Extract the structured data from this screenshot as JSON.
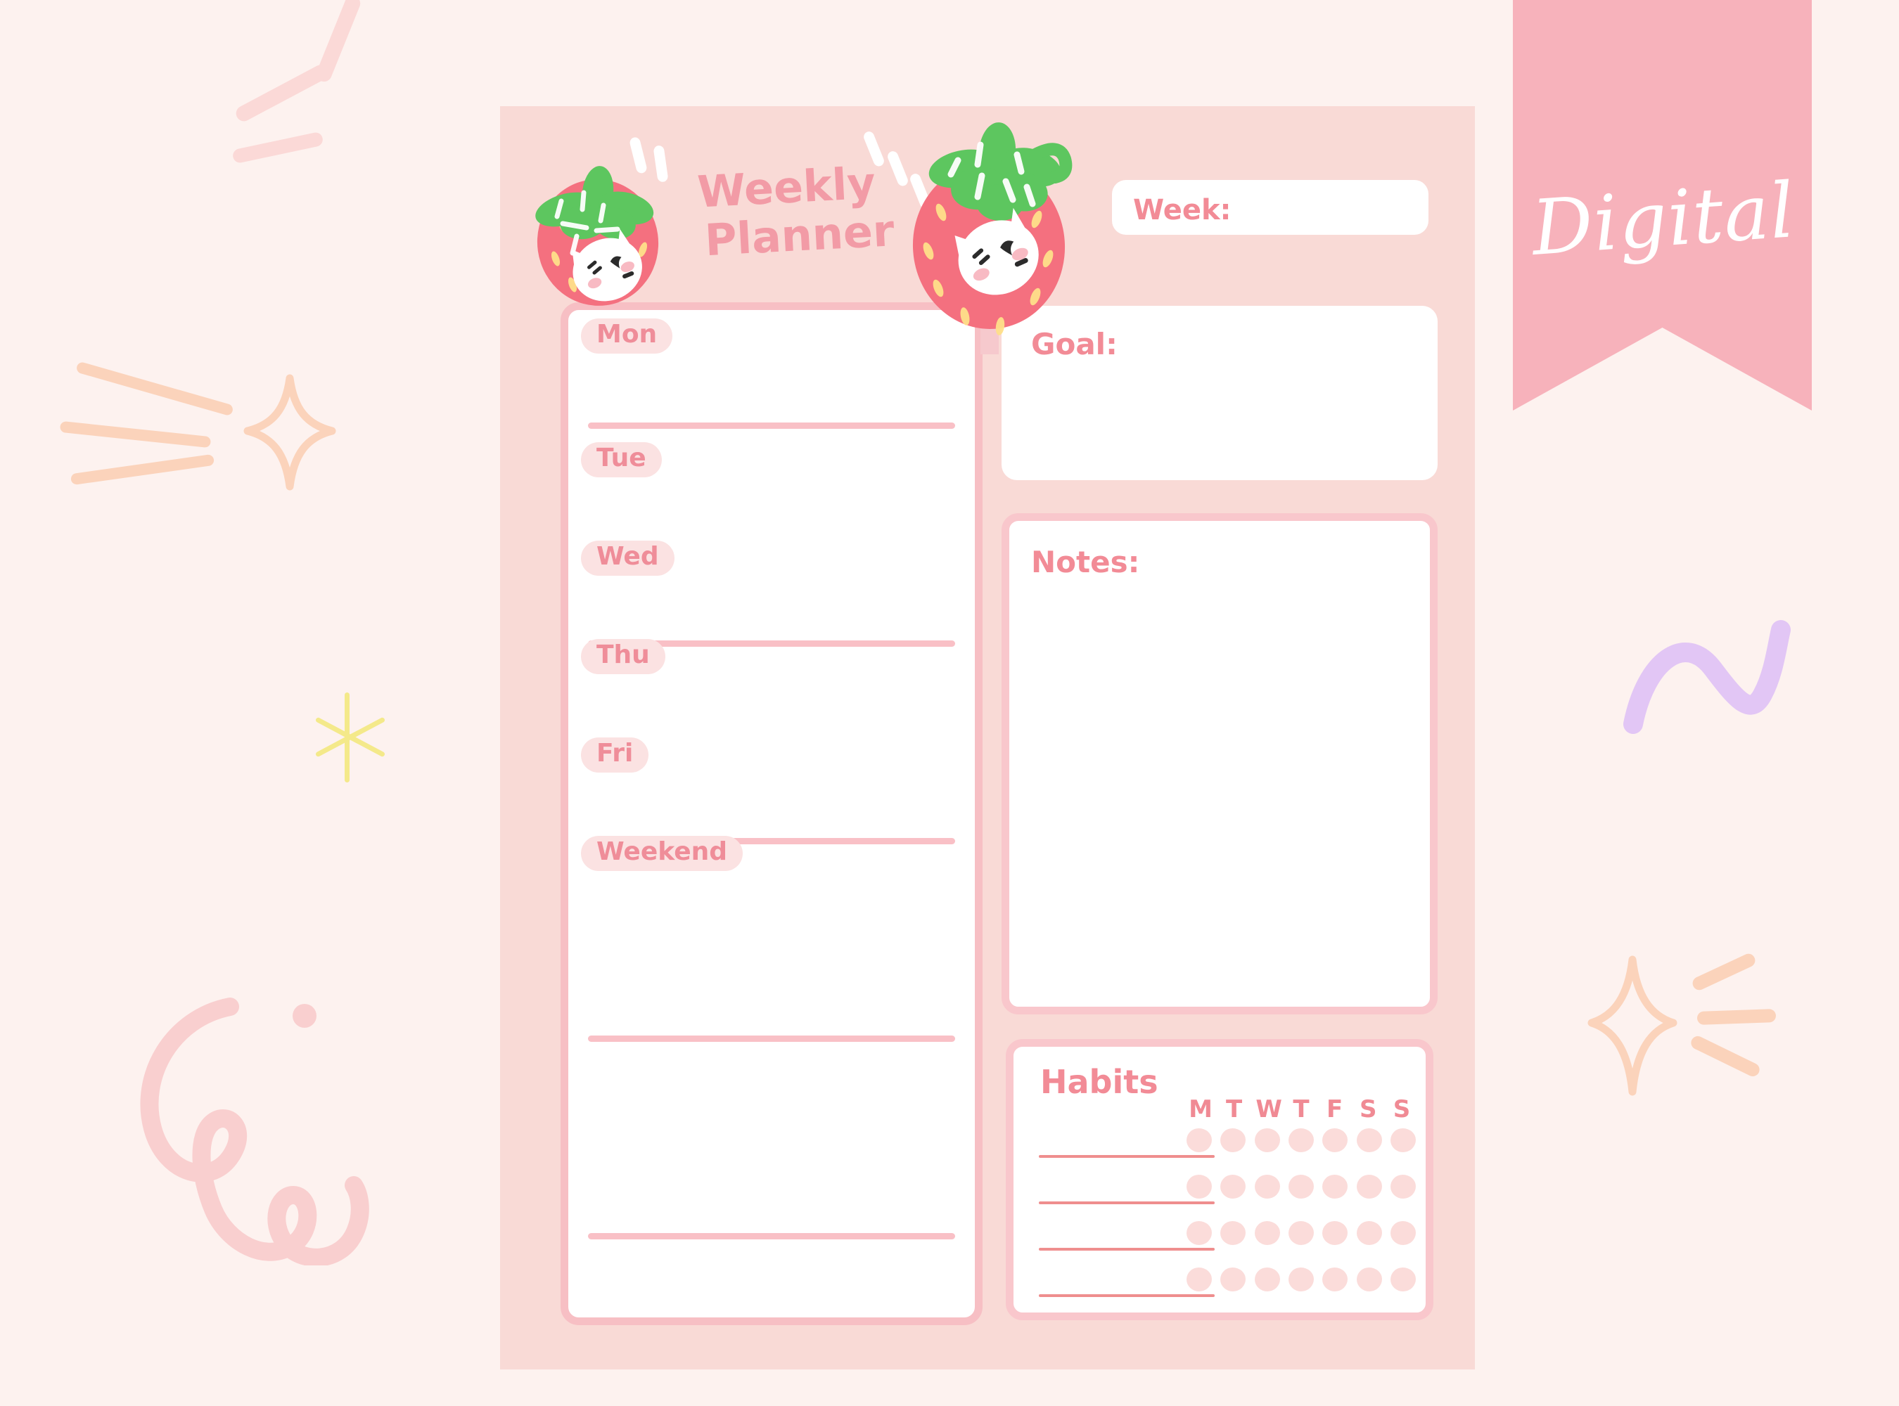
{
  "page": {
    "background_color": "#fdf2ef",
    "card_color": "#f9dad6",
    "accent_pink": "#f28b96",
    "soft_pink": "#f7bfc4",
    "dot_color": "#fbdcda"
  },
  "ribbon": {
    "label": "Digital",
    "color": "#f7b2bb"
  },
  "header": {
    "title_line1": "Weekly",
    "title_line2": "Planner",
    "week_label": "Week:",
    "week_value": ""
  },
  "days": {
    "items": [
      {
        "label": "Mon",
        "value": ""
      },
      {
        "label": "Tue",
        "value": ""
      },
      {
        "label": "Wed",
        "value": ""
      },
      {
        "label": "Thu",
        "value": ""
      },
      {
        "label": "Fri",
        "value": ""
      },
      {
        "label": "Weekend",
        "value": ""
      }
    ]
  },
  "goal": {
    "label": "Goal:",
    "value": ""
  },
  "notes": {
    "label": "Notes:",
    "value": ""
  },
  "habits": {
    "title": "Habits",
    "day_headers": [
      "M",
      "T",
      "W",
      "T",
      "F",
      "S",
      "S"
    ],
    "rows": [
      {
        "name": "",
        "marks": [
          false,
          false,
          false,
          false,
          false,
          false,
          false
        ]
      },
      {
        "name": "",
        "marks": [
          false,
          false,
          false,
          false,
          false,
          false,
          false
        ]
      },
      {
        "name": "",
        "marks": [
          false,
          false,
          false,
          false,
          false,
          false,
          false
        ]
      },
      {
        "name": "",
        "marks": [
          false,
          false,
          false,
          false,
          false,
          false,
          false
        ]
      }
    ]
  },
  "decorations": {
    "sparkle_color": "#fbd3bb",
    "squiggle_color": "#e2c6f5",
    "swirl_color": "#f9cfcf",
    "star_color": "#f4e98a",
    "dash_color": "#fbd9d7"
  }
}
